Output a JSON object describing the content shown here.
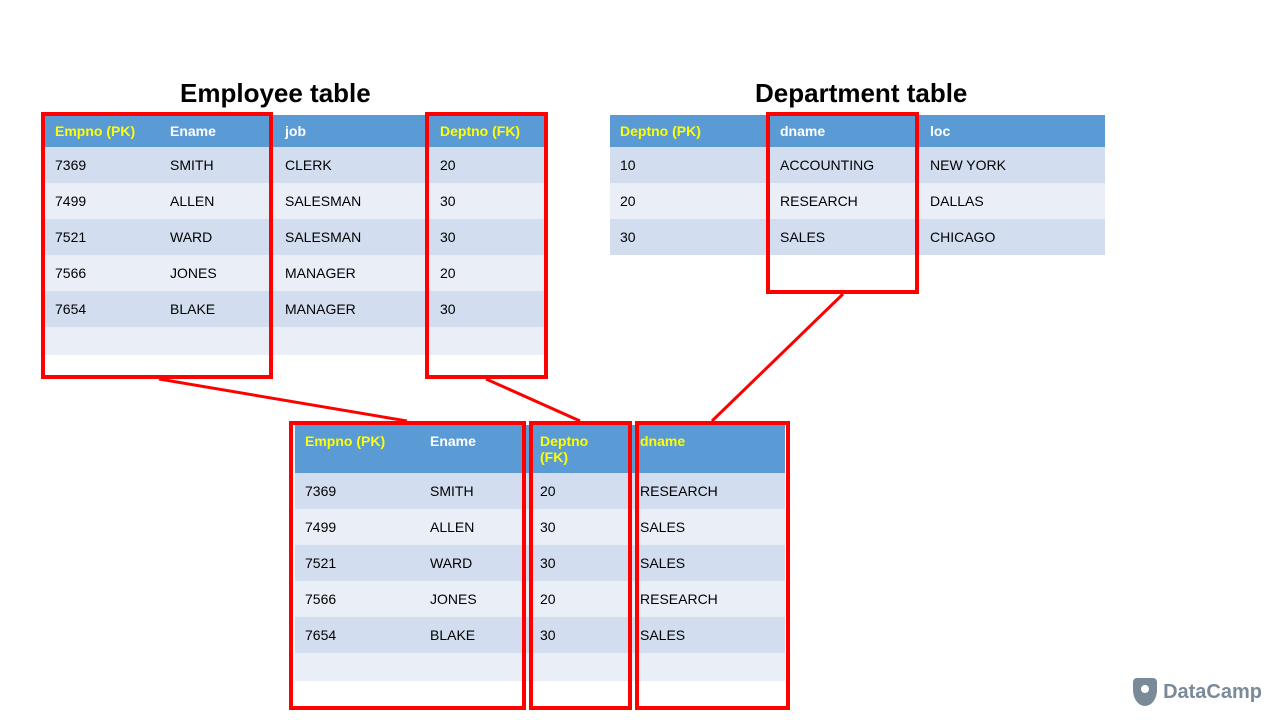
{
  "employee": {
    "title": "Employee table",
    "headers": {
      "empno": "Empno (PK)",
      "ename": "Ename",
      "job": "job",
      "deptno": "Deptno (FK)"
    },
    "rows": [
      {
        "empno": "7369",
        "ename": "SMITH",
        "job": "CLERK",
        "deptno": "20"
      },
      {
        "empno": "7499",
        "ename": "ALLEN",
        "job": "SALESMAN",
        "deptno": "30"
      },
      {
        "empno": "7521",
        "ename": "WARD",
        "job": "SALESMAN",
        "deptno": "30"
      },
      {
        "empno": "7566",
        "ename": "JONES",
        "job": "MANAGER",
        "deptno": "20"
      },
      {
        "empno": "7654",
        "ename": "BLAKE",
        "job": "MANAGER",
        "deptno": "30"
      }
    ]
  },
  "department": {
    "title": "Department table",
    "headers": {
      "deptno": "Deptno (PK)",
      "dname": "dname",
      "loc": "loc"
    },
    "rows": [
      {
        "deptno": "10",
        "dname": "ACCOUNTING",
        "loc": "NEW YORK"
      },
      {
        "deptno": "20",
        "dname": "RESEARCH",
        "loc": "DALLAS"
      },
      {
        "deptno": "30",
        "dname": "SALES",
        "loc": "CHICAGO"
      }
    ]
  },
  "joined": {
    "headers": {
      "empno": "Empno (PK)",
      "ename": "Ename",
      "deptno": "Deptno (FK)",
      "dname": "dname"
    },
    "rows": [
      {
        "empno": "7369",
        "ename": "SMITH",
        "deptno": "20",
        "dname": "RESEARCH"
      },
      {
        "empno": "7499",
        "ename": "ALLEN",
        "deptno": "30",
        "dname": "SALES"
      },
      {
        "empno": "7521",
        "ename": "WARD",
        "deptno": "30",
        "dname": "SALES"
      },
      {
        "empno": "7566",
        "ename": "JONES",
        "deptno": "20",
        "dname": "RESEARCH"
      },
      {
        "empno": "7654",
        "ename": "BLAKE",
        "deptno": "30",
        "dname": "SALES"
      }
    ]
  },
  "brand": "DataCamp"
}
